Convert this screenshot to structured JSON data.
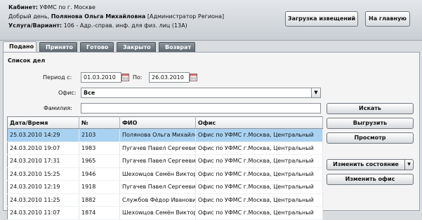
{
  "header": {
    "cabinet_label": "Кабинет:",
    "cabinet_value": "УФМС по г. Москве",
    "greeting": "Добрый день,",
    "user_name": "Полянова Ольга Михайловна",
    "user_role": "[Администратор Региона]",
    "service_label": "Услуга/Вариант:",
    "service_value": "106 - Адр.-справ. инф. для физ. лиц (13А)",
    "load_button": "Загрузка извещений",
    "home_button": "На главную"
  },
  "tabs": [
    "Подано",
    "Принято",
    "Готово",
    "Закрыто",
    "Возврат"
  ],
  "panel": {
    "title": "Список дел",
    "period_label": "Период с:",
    "period_from": "01.03.2010",
    "period_to_label": "По:",
    "period_to": "26.03.2010",
    "office_label": "Офис:",
    "office_value": "Все",
    "surname_label": "Фамилия:",
    "surname_value": ""
  },
  "buttons": {
    "search": "Искать",
    "export": "Выгрузить",
    "view": "Просмотр",
    "change_state": "Изменить состояние",
    "change_office": "Изменить офис"
  },
  "table": {
    "columns": [
      "Дата/Время",
      "№",
      "ФИО",
      "Офис"
    ],
    "rows": [
      [
        "25.03.2010 14:29",
        "2103",
        "Полянова Ольга Михайловна",
        "Офис по УФМС г.Москва, Центральный"
      ],
      [
        "24.03.2010 19:07",
        "1983",
        "Пугачев Павел Сергеевич",
        "Офис по УФМС г.Москва, Центральный"
      ],
      [
        "24.03.2010 17:31",
        "1965",
        "Пугачев Павел Сергеевич",
        "Офис по УФМС г.Москва, Центральный"
      ],
      [
        "24.03.2010 15:25",
        "1946",
        "Шехowцов Семён Викторович",
        "Офис по УФМС г.Москва, Центральный"
      ],
      [
        "24.03.2010 12:19",
        "1918",
        "Пугачев Павел Сергеевич",
        "Офис по УФМС г.Москва, Центральный"
      ],
      [
        "24.03.2010 11:25",
        "1882",
        "Службов Фёдор Иванович",
        "Офис по УФМС г.Москва, Центральный"
      ],
      [
        "24.03.2010 11:07",
        "1874",
        "Шехowцов Семён Викторович",
        "Офис по УФМС г.Москва, Центральный"
      ]
    ],
    "selected_row": 0
  }
}
